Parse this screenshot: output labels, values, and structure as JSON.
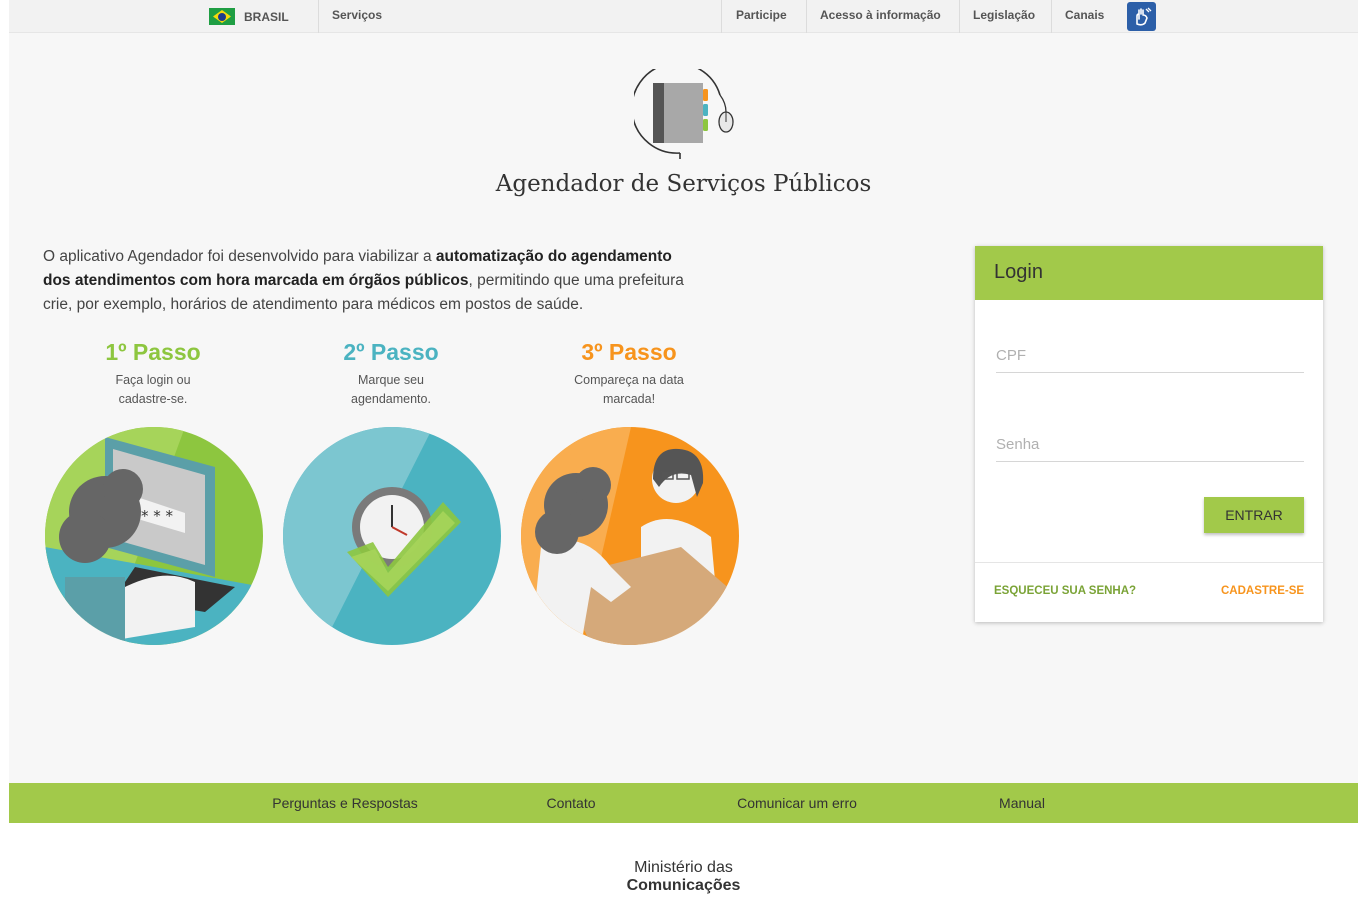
{
  "govbar": {
    "brasil_label": "BRASIL",
    "servicos_label": "Serviços",
    "links": [
      "Participe",
      "Acesso à informação",
      "Legislação",
      "Canais"
    ],
    "accessibility_icon": "hand-sign-language-icon",
    "flag_icon": "brazil-flag-icon"
  },
  "app": {
    "title": "Agendador de Serviços Públicos",
    "logo_icon": "agenda-book-mouse-icon"
  },
  "intro": {
    "part1": "O aplicativo Agendador foi desenvolvido para viabilizar a ",
    "bold": "automatização do agendamento dos atendimentos com hora marcada em órgãos públicos",
    "part2": ", permitindo que uma prefeitura crie, por exemplo, horários de atendimento para médicos em postos de saúde."
  },
  "steps": [
    {
      "title": "1º Passo",
      "line1": "Faça login ou",
      "line2": "cadastre-se.",
      "color": "#8dc63f",
      "image": "person-at-computer-login-illustration"
    },
    {
      "title": "2º Passo",
      "line1": "Marque seu",
      "line2": "agendamento.",
      "color": "#4bb3c1",
      "image": "clock-with-checkmark-illustration"
    },
    {
      "title": "3º Passo",
      "line1": "Compareça na data",
      "line2": "marcada!",
      "color": "#f7941d",
      "image": "patient-meeting-doctor-illustration"
    }
  ],
  "login": {
    "title": "Login",
    "cpf_placeholder": "CPF",
    "senha_placeholder": "Senha",
    "submit_label": "ENTRAR",
    "forgot_label": "ESQUECEU SUA SENHA?",
    "register_label": "CADASTRE-SE",
    "accent": "#a2c94a",
    "forgot_color": "#7aa336",
    "register_color": "#f7941d"
  },
  "footer": {
    "links": [
      "Perguntas e Respostas",
      "Contato",
      "Comunicar um erro",
      "Manual"
    ],
    "ministry_line1": "Ministério das",
    "ministry_line2": "Comunicações"
  }
}
